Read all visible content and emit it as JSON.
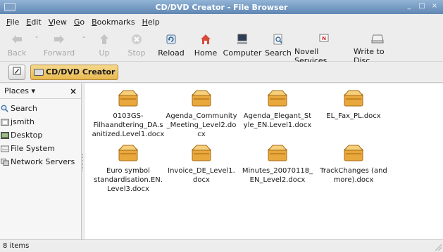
{
  "window": {
    "title": "CD/DVD Creator - File Browser",
    "minimize": "_",
    "maximize": "□",
    "close": "×"
  },
  "menu": {
    "items": [
      {
        "label": "File",
        "mnemonic": "F",
        "rest": "ile"
      },
      {
        "label": "Edit",
        "mnemonic": "E",
        "rest": "dit"
      },
      {
        "label": "View",
        "mnemonic": "V",
        "rest": "iew"
      },
      {
        "label": "Go",
        "mnemonic": "G",
        "rest": "o"
      },
      {
        "label": "Bookmarks",
        "mnemonic": "B",
        "rest": "ookmarks"
      },
      {
        "label": "Help",
        "mnemonic": "H",
        "rest": "elp"
      }
    ]
  },
  "toolbar": {
    "back": {
      "label": "Back",
      "icon": "back-arrow-icon",
      "enabled": false
    },
    "forward": {
      "label": "Forward",
      "icon": "forward-arrow-icon",
      "enabled": false
    },
    "up": {
      "label": "Up",
      "icon": "up-arrow-icon",
      "enabled": false
    },
    "stop": {
      "label": "Stop",
      "icon": "stop-icon",
      "enabled": false
    },
    "reload": {
      "label": "Reload",
      "icon": "reload-icon",
      "enabled": true
    },
    "home": {
      "label": "Home",
      "icon": "home-icon",
      "enabled": true
    },
    "computer": {
      "label": "Computer",
      "icon": "computer-icon",
      "enabled": true
    },
    "search": {
      "label": "Search",
      "icon": "search-icon",
      "enabled": true
    },
    "novell": {
      "label": "Novell Services",
      "icon": "novell-icon",
      "enabled": true
    },
    "write": {
      "label": "Write to Disc",
      "icon": "disc-drive-icon",
      "enabled": true
    }
  },
  "location": {
    "crumb": "CD/DVD Creator"
  },
  "sidebar": {
    "header": "Places",
    "close": "×",
    "items": [
      {
        "label": "Search",
        "icon": "search-icon"
      },
      {
        "label": "jsmith",
        "icon": "home-folder-icon"
      },
      {
        "label": "Desktop",
        "icon": "desktop-icon"
      },
      {
        "label": "File System",
        "icon": "drive-icon"
      },
      {
        "label": "Network Servers",
        "icon": "network-icon"
      }
    ]
  },
  "files": [
    {
      "name": "0103GS-Filhaandtering_DA.sanitized.Level1.docx",
      "lines": [
        "0103GS-",
        "Filhaandtering_DA.s",
        "anitized.Level1.docx"
      ]
    },
    {
      "name": "Agenda_Community_Meeting_Level2.docx",
      "lines": [
        "Agenda_Community",
        "_Meeting_Level2.do",
        "cx"
      ]
    },
    {
      "name": "Agenda_Elegant_Style_EN.Level1.docx",
      "lines": [
        "Agenda_Elegant_St",
        "yle_EN.Level1.docx"
      ]
    },
    {
      "name": "EL_Fax_PL.docx",
      "lines": [
        "EL_Fax_PL.docx"
      ]
    },
    {
      "name": "Euro symbol standardisation.EN.Level3.docx",
      "lines": [
        "Euro symbol",
        "standardisation.EN.",
        "Level3.docx"
      ]
    },
    {
      "name": "Invoice_DE_Level1.docx",
      "lines": [
        "Invoice_DE_Level1.",
        "docx"
      ]
    },
    {
      "name": "Minutes_20070118_EN_Level2.docx",
      "lines": [
        "Minutes_20070118_",
        "EN_Level2.docx"
      ]
    },
    {
      "name": "TrackChanges (and more).docx",
      "lines": [
        "TrackChanges (and",
        "more).docx"
      ]
    }
  ],
  "status": {
    "text": "8 items"
  },
  "colors": {
    "titlebar": "#6f93bd",
    "crumb": "#efc766",
    "file_icon": "#e8a83c"
  }
}
